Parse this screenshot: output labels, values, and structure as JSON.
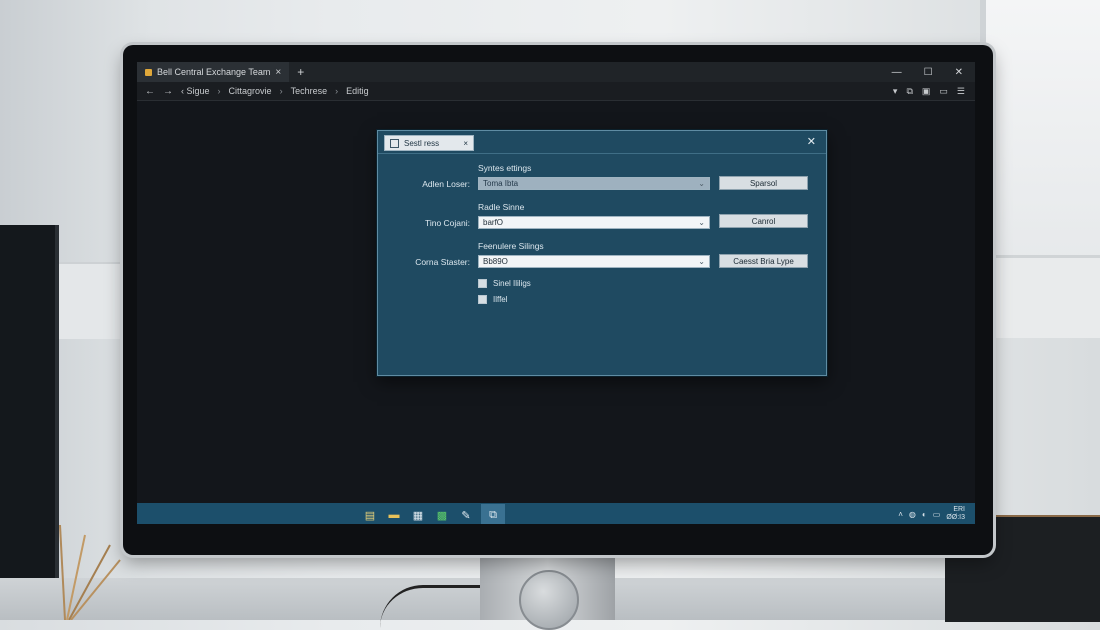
{
  "browser": {
    "tab_title": "Bell Central Exchange Team",
    "tab_close": "×",
    "new_tab": "+",
    "window_controls": {
      "minimize": "—",
      "maximize": "☐",
      "close": "✕"
    },
    "nav": {
      "back": "←",
      "forward": "→"
    },
    "breadcrumb": [
      "‹ Sigue",
      "Cittagrovie",
      "Techrese",
      "Editig"
    ],
    "breadcrumb_sep": "›"
  },
  "dialog": {
    "tab_label": "Sestl ress",
    "tab_close": "×",
    "close": "✕",
    "sections": [
      {
        "heading": "Syntes ettings",
        "label": "Adlen Loser:",
        "value": "Toma Ibta",
        "style": "dim",
        "button": "Sparsol"
      },
      {
        "heading": "Radle Sinne",
        "label": "Tino Cojani:",
        "value": "barfO",
        "style": "light",
        "button": "Canrol"
      },
      {
        "heading": "Feenulere Silings",
        "label": "Corna Staster:",
        "value": "Bb89O",
        "style": "light",
        "button": "Caesst Bria Lype"
      }
    ],
    "checkboxes": [
      {
        "label": "Sinel Ililigs",
        "checked": false
      },
      {
        "label": "Ilffel",
        "checked": false
      }
    ]
  },
  "taskbar": {
    "tray_time": "ERI",
    "tray_date": "ØØ:I3"
  }
}
